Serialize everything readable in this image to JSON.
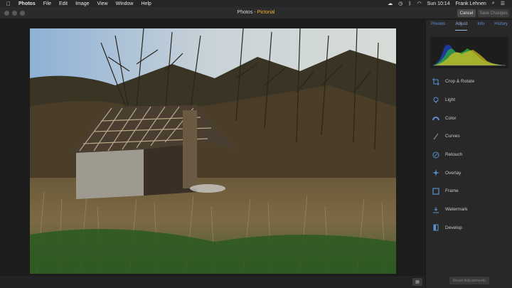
{
  "menubar": {
    "items": [
      "Photos",
      "File",
      "Edit",
      "Image",
      "View",
      "Window",
      "Help"
    ],
    "time": "Sun 10:14",
    "user": "Frank Lehnen"
  },
  "window": {
    "title_app": "Photos",
    "title_sep": " - ",
    "title_doc": "Pictorial",
    "cancel_label": "Cancel",
    "save_label": "Save Changes"
  },
  "panel": {
    "tabs": [
      "Presets",
      "Adjust",
      "Info",
      "History"
    ],
    "active_tab": "Adjust",
    "tools": [
      {
        "label": "Crop & Rotate",
        "icon": "crop-rotate-icon"
      },
      {
        "label": "Light",
        "icon": "light-bulb-icon"
      },
      {
        "label": "Color",
        "icon": "color-arc-icon"
      },
      {
        "label": "Curves",
        "icon": "curves-icon"
      },
      {
        "label": "Retouch",
        "icon": "retouch-brush-icon"
      },
      {
        "label": "Overlay",
        "icon": "overlay-icon"
      },
      {
        "label": "Frame",
        "icon": "frame-icon"
      },
      {
        "label": "Watermark",
        "icon": "watermark-icon"
      },
      {
        "label": "Develop",
        "icon": "develop-icon"
      }
    ],
    "reset_label": "Reset Adjustments",
    "accent": "#5b8fd0"
  }
}
